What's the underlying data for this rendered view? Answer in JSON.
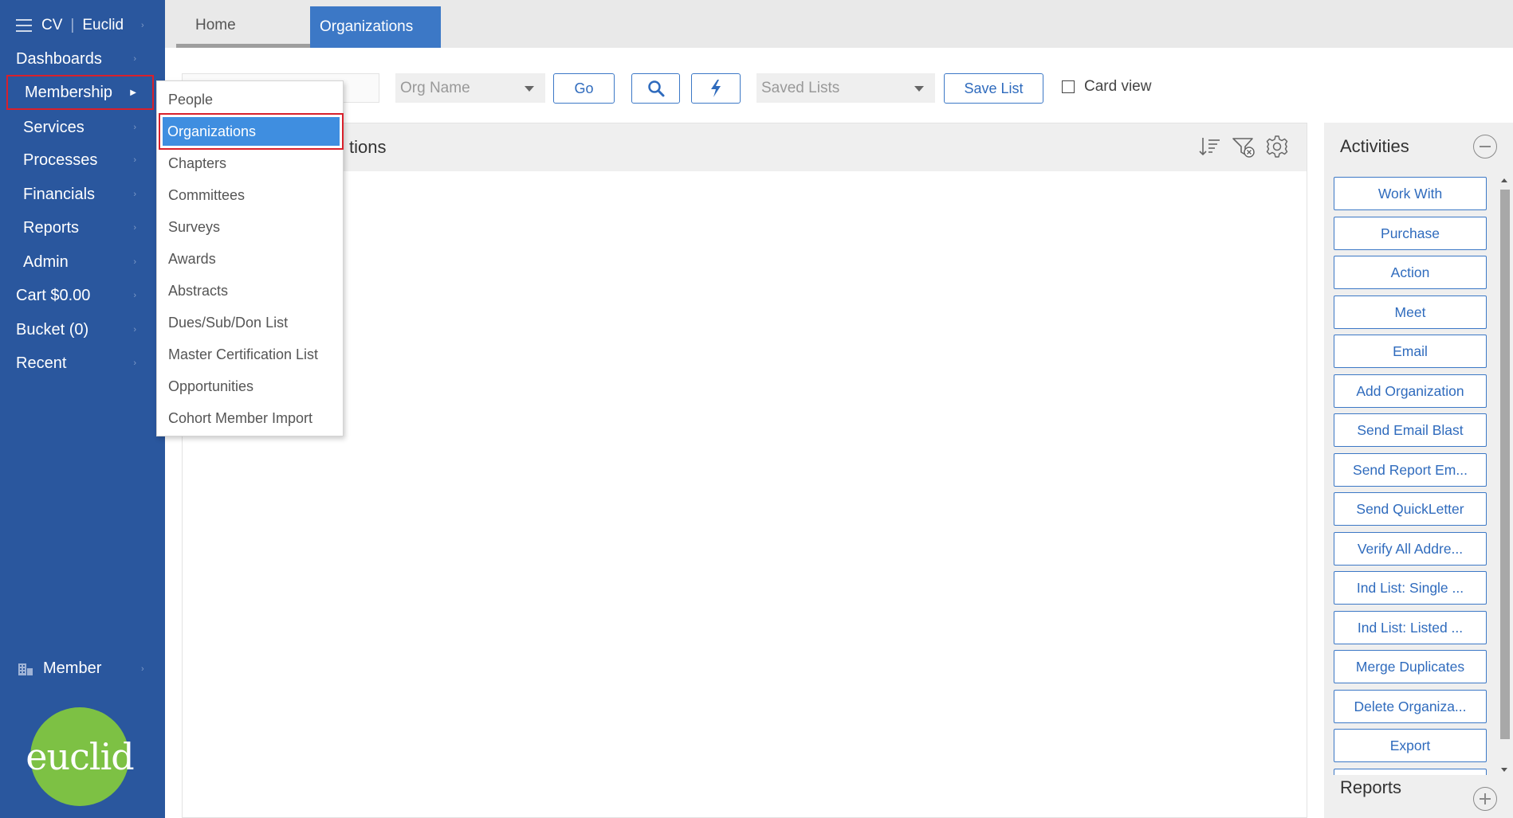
{
  "sidebar": {
    "app": "CV",
    "org": "Euclid",
    "items": [
      {
        "label": "Dashboards"
      },
      {
        "label": "Membership"
      },
      {
        "label": "Services"
      },
      {
        "label": "Processes"
      },
      {
        "label": "Financials"
      },
      {
        "label": "Reports"
      },
      {
        "label": "Admin"
      },
      {
        "label": "Cart $0.00"
      },
      {
        "label": "Bucket (0)"
      },
      {
        "label": "Recent"
      }
    ],
    "member_label": "Member",
    "logo_text": "euclid"
  },
  "tabs": [
    {
      "label": "Home"
    },
    {
      "label": "Organizations"
    }
  ],
  "toolbar": {
    "org_name_dropdown": "Org Name",
    "go_label": "Go",
    "saved_lists_dropdown": "Saved Lists",
    "save_list_label": "Save List",
    "card_view_label": "Card view"
  },
  "main": {
    "title_visible": "tions"
  },
  "flyout": {
    "items": [
      {
        "label": "People"
      },
      {
        "label": "Organizations"
      },
      {
        "label": "Chapters"
      },
      {
        "label": "Committees"
      },
      {
        "label": "Surveys"
      },
      {
        "label": "Awards"
      },
      {
        "label": "Abstracts"
      },
      {
        "label": "Dues/Sub/Don List"
      },
      {
        "label": "Master Certification List"
      },
      {
        "label": "Opportunities"
      },
      {
        "label": "Cohort Member Import"
      }
    ]
  },
  "activities": {
    "title": "Activities",
    "buttons": [
      {
        "label": "Work With"
      },
      {
        "label": "Purchase"
      },
      {
        "label": "Action"
      },
      {
        "label": "Meet"
      },
      {
        "label": "Email"
      },
      {
        "label": "Add Organization"
      },
      {
        "label": "Send Email Blast"
      },
      {
        "label": "Send Report Em..."
      },
      {
        "label": "Send QuickLetter"
      },
      {
        "label": "Verify All Addre..."
      },
      {
        "label": "Ind List: Single ..."
      },
      {
        "label": "Ind List: Listed ..."
      },
      {
        "label": "Merge Duplicates"
      },
      {
        "label": "Delete Organiza..."
      },
      {
        "label": "Export"
      }
    ]
  },
  "reports_panel": {
    "title": "Reports"
  },
  "colors": {
    "sidebar_bg": "#2a579e",
    "active_tab": "#3c78c6",
    "highlight_border": "#d9202b",
    "selected_item": "#3f8ee0",
    "logo_green": "#7dc144"
  }
}
